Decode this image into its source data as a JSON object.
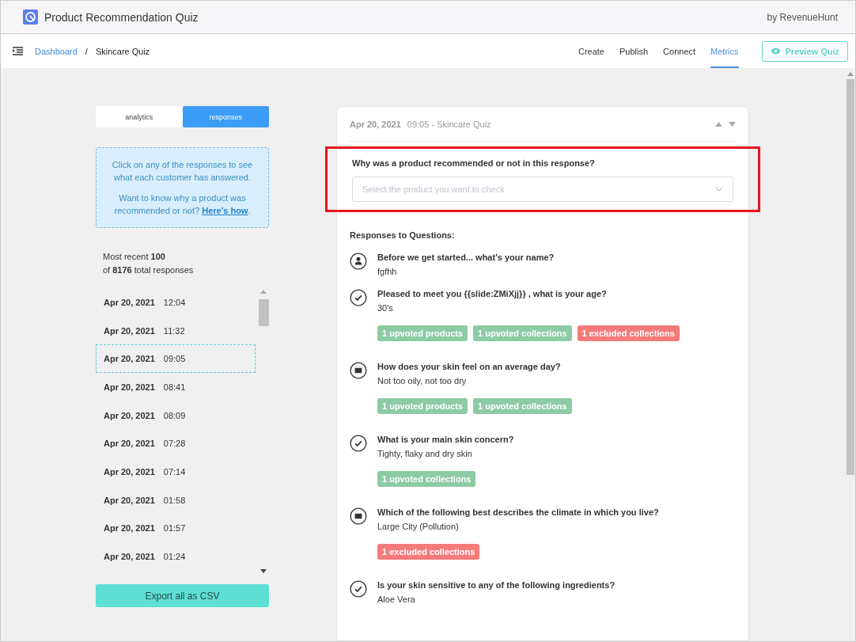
{
  "app": {
    "title": "Product Recommendation Quiz",
    "byline": "by RevenueHunt"
  },
  "breadcrumb": [
    {
      "label": "Dashboard",
      "link": true
    },
    {
      "label": "Skincare Quiz",
      "link": false
    }
  ],
  "breadcrumb_separator": "/",
  "nav": [
    {
      "label": "Create",
      "selected": false
    },
    {
      "label": "Publish",
      "selected": false
    },
    {
      "label": "Connect",
      "selected": false
    },
    {
      "label": "Metrics",
      "selected": true
    }
  ],
  "preview_button": "Preview Quiz",
  "view_tabs": [
    {
      "label": "analytics",
      "selected": false
    },
    {
      "label": "responses",
      "selected": true
    }
  ],
  "info": {
    "line1": "Click on any of the responses to see what each customer has answered.",
    "line2": "Want to know why a product was recommended or not?",
    "link": "Here's how",
    "after": "."
  },
  "count": [
    "Most recent **100**",
    "of **8176** total responses"
  ],
  "responses": [
    {
      "date": "Apr 20, 2021",
      "time": "12:04",
      "selected": false
    },
    {
      "date": "Apr 20, 2021",
      "time": "11:32",
      "selected": false
    },
    {
      "date": "Apr 20, 2021",
      "time": "09:05",
      "selected": true
    },
    {
      "date": "Apr 20, 2021",
      "time": "08:41",
      "selected": false
    },
    {
      "date": "Apr 20, 2021",
      "time": "08:09",
      "selected": false
    },
    {
      "date": "Apr 20, 2021",
      "time": "07:28",
      "selected": false
    },
    {
      "date": "Apr 20, 2021",
      "time": "07:14",
      "selected": false
    },
    {
      "date": "Apr 20, 2021",
      "time": "01:58",
      "selected": false
    },
    {
      "date": "Apr 20, 2021",
      "time": "01:57",
      "selected": false
    },
    {
      "date": "Apr 20, 2021",
      "time": "01:24",
      "selected": false
    }
  ],
  "export_button": "Export all as CSV",
  "detail": {
    "date": "Apr 20, 2021",
    "title": "09:05 - Skincare Quiz",
    "check": {
      "question": "Why was a product recommended or not in this response?",
      "placeholder": "Select the product you want to check",
      "highlighted": true
    },
    "responses_heading": "Responses to Questions:",
    "questions": [
      {
        "kind": "person",
        "question": "Before we get started... what's your name?",
        "answer": "fgfhh"
      },
      {
        "kind": "check",
        "question": "Pleased to meet you {{slide:ZMiXjj}} , what is your age?",
        "answer": "30's",
        "tags": [
          {
            "kind": "upvoted",
            "label": "1 upvoted products"
          },
          {
            "kind": "upvoted",
            "label": "1 upvoted collections"
          },
          {
            "kind": "excluded",
            "label": "1 excluded collections"
          }
        ]
      },
      {
        "kind": "image",
        "question": "How does your skin feel on an average day?",
        "answer": "Not too oily, not too dry",
        "tags": [
          {
            "kind": "upvoted",
            "label": "1 upvoted products"
          },
          {
            "kind": "upvoted",
            "label": "1 upvoted collections"
          }
        ]
      },
      {
        "kind": "check",
        "question": "What is your main skin concern?",
        "answer": "Tighty, flaky and dry skin",
        "tags": [
          {
            "kind": "upvoted",
            "label": "1 upvoted collections"
          }
        ]
      },
      {
        "kind": "image",
        "question": "Which of the following best describes the climate in which you live?",
        "answer": "Large City (Pollution)",
        "tags": [
          {
            "kind": "excluded",
            "label": "1 excluded collections"
          }
        ]
      },
      {
        "kind": "check",
        "question": "Is your skin sensitive to any of the following ingredients?",
        "answer": "Aloe Vera"
      }
    ]
  }
}
